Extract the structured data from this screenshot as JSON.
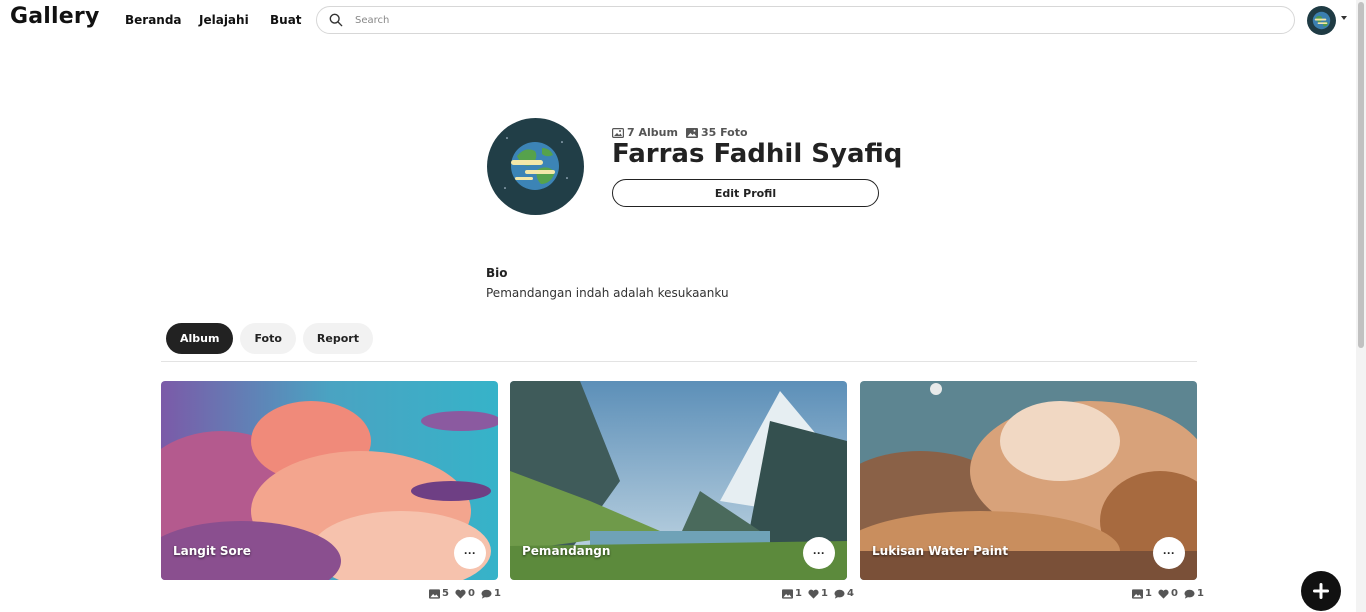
{
  "navbar": {
    "brand": "Gallery",
    "links": [
      "Beranda",
      "Jelajahi",
      "Buat"
    ],
    "search_placeholder": "Search"
  },
  "profile": {
    "album_count": "7 Album",
    "photo_count": "35 Foto",
    "name": "Farras Fadhil Syafiq",
    "edit_label": "Edit Profil",
    "bio_heading": "Bio",
    "bio_text": "Pemandangan indah adalah kesukaanku"
  },
  "tabs": [
    {
      "label": "Album",
      "active": true
    },
    {
      "label": "Foto",
      "active": false
    },
    {
      "label": "Report",
      "active": false
    }
  ],
  "albums": [
    {
      "title": "Langit Sore",
      "photos": "5",
      "likes": "0",
      "comments": "1"
    },
    {
      "title": "Pemandangn",
      "photos": "1",
      "likes": "1",
      "comments": "4"
    },
    {
      "title": "Lukisan Water Paint",
      "photos": "1",
      "likes": "0",
      "comments": "1"
    }
  ],
  "card_menu_label": "···",
  "icons": {
    "search": "search-icon",
    "album": "album-icon",
    "photo": "image-icon",
    "like": "heart-icon",
    "comment": "comment-icon",
    "add": "plus-icon"
  }
}
